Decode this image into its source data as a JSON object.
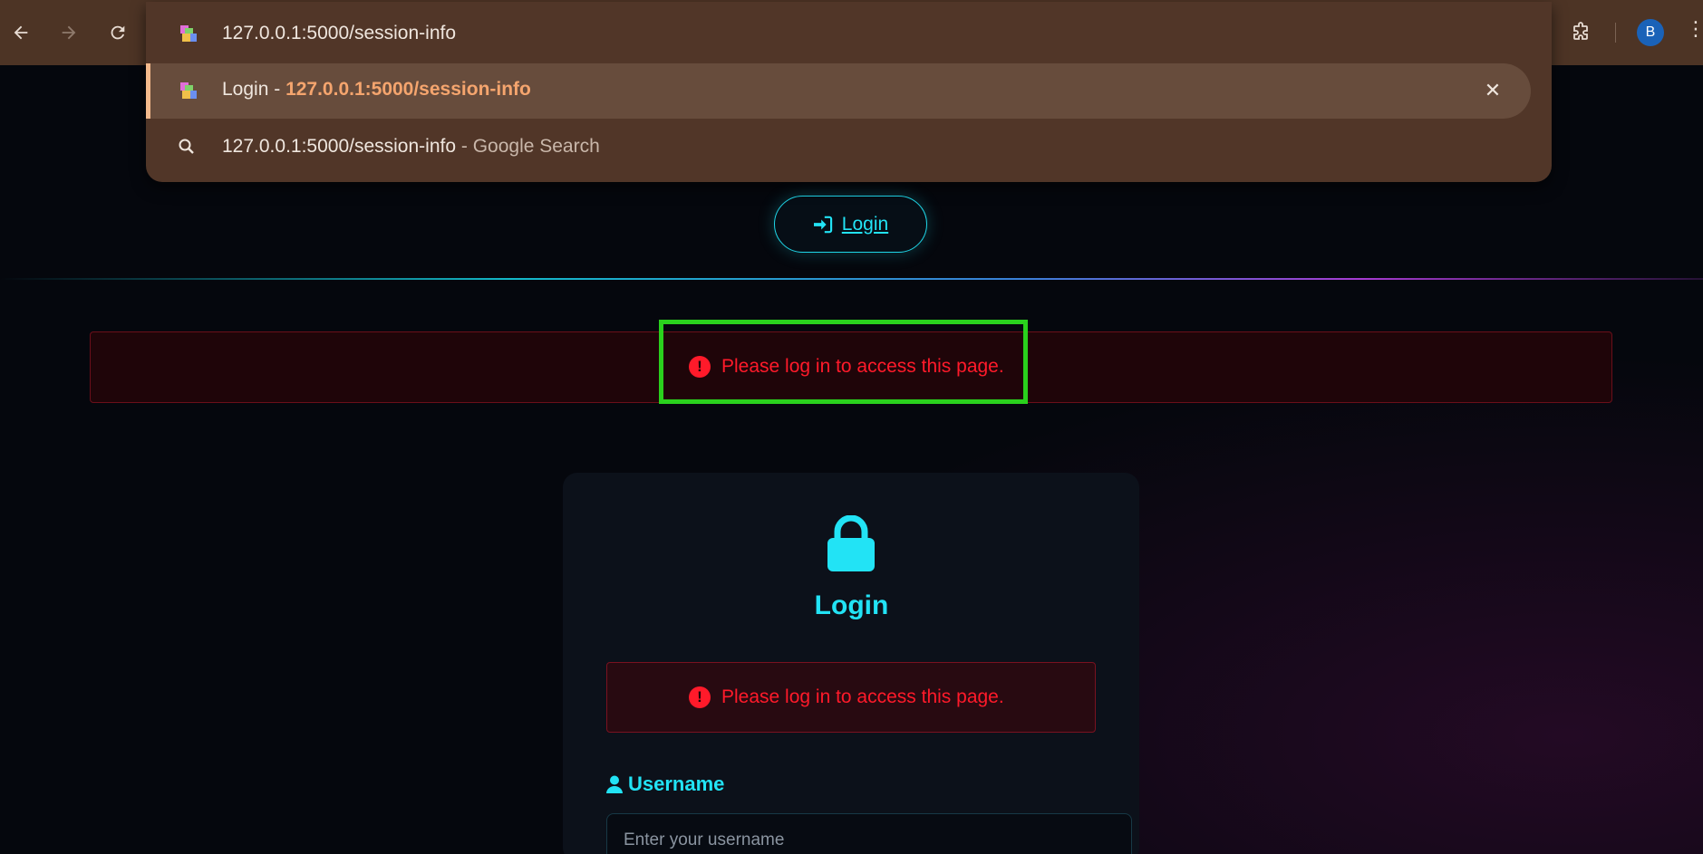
{
  "browser": {
    "address": "127.0.0.1:5000/session-info",
    "profile_initial": "B"
  },
  "omnibox": {
    "suggestions": [
      {
        "title": "Login",
        "separator": " - ",
        "url": "127.0.0.1:5000/session-info"
      },
      {
        "query": "127.0.0.1:5000/session-info",
        "suffix": " - Google Search"
      }
    ]
  },
  "header": {
    "login_button": "Login"
  },
  "flash": {
    "message": "Please log in to access this page."
  },
  "card": {
    "title": "Login",
    "flash_message": "Please log in to access this page.",
    "username_label": "Username",
    "username_placeholder": "Enter your username",
    "username_value": ""
  },
  "colors": {
    "accent": "#22e3f5",
    "error": "#ff1a2a",
    "highlight": "#2ad11d",
    "chrome": "#4d3425"
  }
}
